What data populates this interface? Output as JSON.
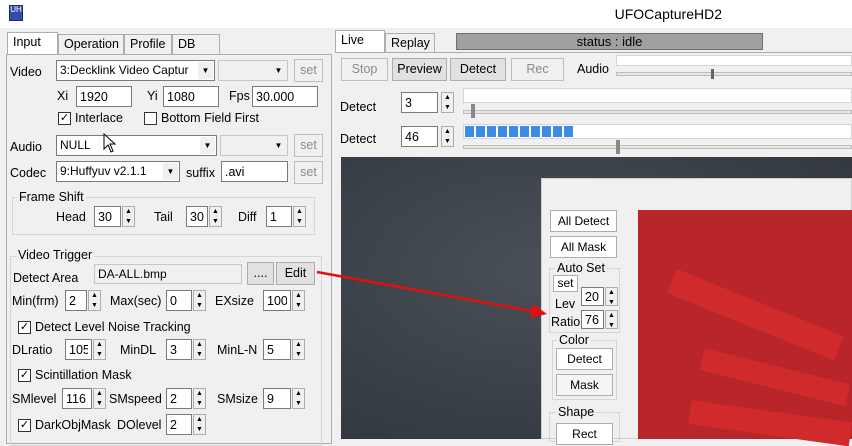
{
  "window": {
    "title": "UFOCaptureHD2",
    "icon_label": "UH"
  },
  "left_tabs": [
    "Input",
    "Operation",
    "Profile",
    "DB"
  ],
  "input": {
    "video_label": "Video",
    "video_device": "3:Decklink Video Captur",
    "video_set": "set",
    "xi_label": "Xi",
    "xi_value": "1920",
    "yi_label": "Yi",
    "yi_value": "1080",
    "fps_label": "Fps",
    "fps_value": "30.000",
    "interlace_label": "Interlace",
    "interlace_checked": true,
    "bottom_field_label": "Bottom Field First",
    "bottom_field_checked": false,
    "audio_label": "Audio",
    "audio_device": "NULL",
    "audio_set": "set",
    "codec_label": "Codec",
    "codec_value": "9:Huffyuv v2.1.1",
    "suffix_label": "suffix",
    "suffix_value": ".avi",
    "codec_set": "set"
  },
  "frame_shift": {
    "title": "Frame Shift",
    "head_label": "Head",
    "head_value": "30",
    "tail_label": "Tail",
    "tail_value": "30",
    "diff_label": "Diff",
    "diff_value": "1"
  },
  "video_trigger": {
    "title": "Video Trigger",
    "detect_area_label": "Detect Area",
    "detect_area_value": "DA-ALL.bmp",
    "browse": "....",
    "edit": "Edit",
    "min_label": "Min(frm)",
    "min_value": "2",
    "max_label": "Max(sec)",
    "max_value": "0",
    "exsize_label": "EXsize",
    "exsize_value": "100",
    "noise_tracking_label": "Detect Level Noise Tracking",
    "noise_tracking_checked": true,
    "dlratio_label": "DLratio",
    "dlratio_value": "105",
    "mindl_label": "MinDL",
    "mindl_value": "3",
    "minln_label": "MinL-N",
    "minln_value": "5",
    "scint_label": "Scintillation Mask",
    "scint_checked": true,
    "smlevel_label": "SMlevel",
    "smlevel_value": "116",
    "smspeed_label": "SMspeed",
    "smspeed_value": "2",
    "smsize_label": "SMsize",
    "smsize_value": "9",
    "darkobj_label": "DarkObjMask",
    "darkobj_checked": true,
    "dolevel_label": "DOlevel",
    "dolevel_value": "2"
  },
  "right_tabs": [
    "Live",
    "Replay"
  ],
  "status": {
    "text": "status : idle"
  },
  "toolbar": {
    "stop": "Stop",
    "preview": "Preview",
    "detect": "Detect",
    "rec": "Rec",
    "audio_label": "Audio"
  },
  "detect_rows": [
    {
      "label": "Detect",
      "value": "3"
    },
    {
      "label": "Detect",
      "value": "46"
    }
  ],
  "detect_level_fraction": 0.3,
  "popup": {
    "all_detect": "All Detect",
    "all_mask": "All Mask",
    "auto_set_title": "Auto Set",
    "set": "set",
    "lev_label": "Lev",
    "lev_value": "20",
    "ratio_label": "Ratio",
    "ratio_value": "76",
    "color_title": "Color",
    "color_detect": "Detect",
    "color_mask": "Mask",
    "shape_title": "Shape",
    "shape_rect": "Rect"
  },
  "colors": {
    "accent": "#3c8ce6",
    "mask_red": "#b8262a",
    "arrow": "#e01010"
  }
}
